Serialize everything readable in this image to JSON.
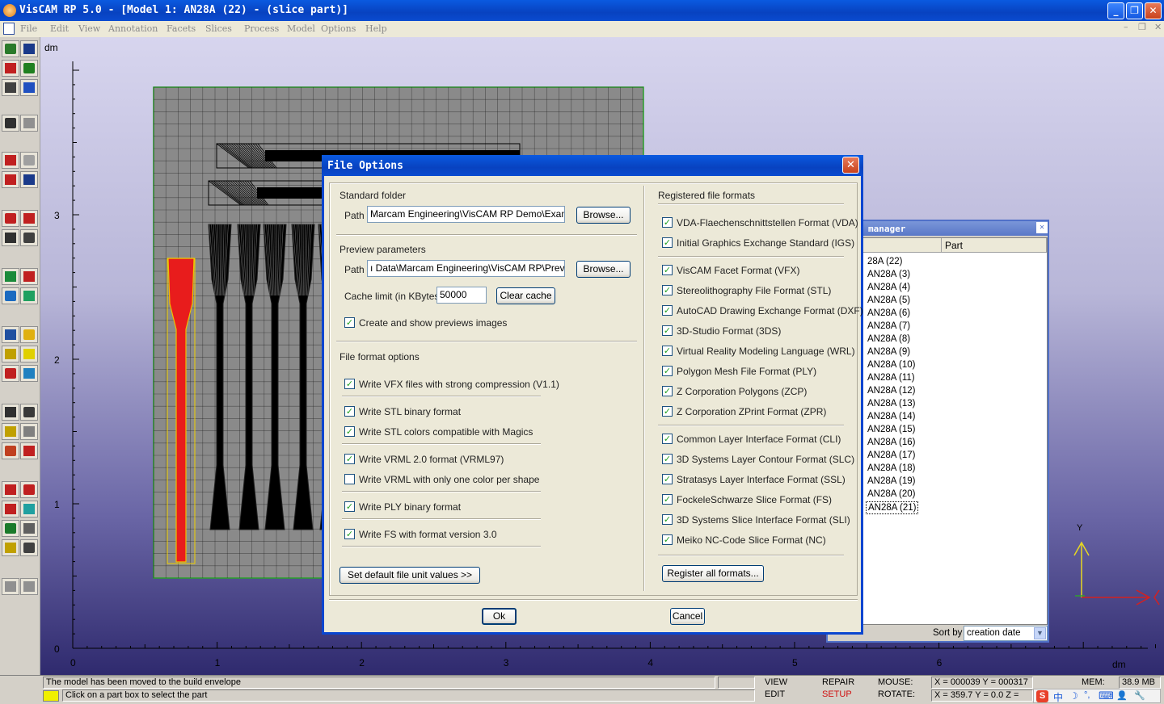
{
  "window": {
    "title": "VisCAM RP 5.0 - [Model 1: AN28A (22) - (slice part)]",
    "minimize": "_",
    "restore": "❐",
    "close": "✕"
  },
  "menu": {
    "items": [
      "File",
      "Edit",
      "View",
      "Annotation",
      "Facets",
      "Slices",
      "Process",
      "Model",
      "Options",
      "Help"
    ],
    "mdi_controls": [
      "–",
      "❐",
      "✕"
    ]
  },
  "toolbar": {
    "buttons": [
      "open",
      "save",
      "cut",
      "copy",
      "print",
      "paint",
      "undo",
      "redo",
      "rp-slice",
      "layers",
      "sort-down",
      "toggle",
      "layer-down",
      "layer-up",
      "stack",
      "stack2",
      "cube",
      "no-select",
      "move",
      "rotate-face",
      "part-dim",
      "settings",
      "grid",
      "grid-fill",
      "transform",
      "rotate",
      "ruler",
      "dollar",
      "hatch",
      "hatch-x",
      "layer-fill",
      "cross",
      "cube-red",
      "cube-box",
      "flip",
      "globe",
      "move-arrows",
      "rotate-arc",
      "lasso",
      "zoom",
      "back",
      "forward"
    ],
    "accent": "#c02020"
  },
  "viewport": {
    "y_unit": "dm",
    "x_unit": "dm",
    "y_ticks": [
      {
        "v": 0,
        "label": "0"
      },
      {
        "v": 1,
        "label": "1"
      },
      {
        "v": 2,
        "label": "2"
      },
      {
        "v": 3,
        "label": "3"
      }
    ],
    "x_ticks": [
      {
        "v": 0,
        "label": "0"
      },
      {
        "v": 1,
        "label": "1"
      },
      {
        "v": 2,
        "label": "2"
      },
      {
        "v": 3,
        "label": "3"
      },
      {
        "v": 4,
        "label": "4"
      },
      {
        "v": 5,
        "label": "5"
      },
      {
        "v": 6,
        "label": "6"
      }
    ],
    "axis_y_label": "Y",
    "colors": {
      "plate": "#8a8a8a",
      "grid": "#1a1a1a",
      "border": "#2aa02a",
      "selected": "#e81c1c",
      "axis": "#e8d820",
      "axis_x": "#d42020"
    }
  },
  "parts_manager": {
    "title": "manager",
    "columns": [
      "",
      "Part"
    ],
    "rows": [
      "28A (22)",
      "AN28A (3)",
      "AN28A (4)",
      "AN28A (5)",
      "AN28A (6)",
      "AN28A (7)",
      "AN28A (8)",
      "AN28A (9)",
      "AN28A (10)",
      "AN28A (11)",
      "AN28A (12)",
      "AN28A (13)",
      "AN28A (14)",
      "AN28A (15)",
      "AN28A (16)",
      "AN28A (17)",
      "AN28A (18)",
      "AN28A (19)",
      "AN28A (20)",
      "AN28A (21)"
    ],
    "sort_label": "Sort by",
    "sort_value": "creation date",
    "close": "✕"
  },
  "dialog": {
    "title": "File Options",
    "close": "✕",
    "standard_folder": {
      "heading": "Standard folder",
      "path_label": "Path",
      "path_value": "Marcam Engineering\\VisCAM RP Demo\\Examples\\",
      "browse": "Browse..."
    },
    "preview": {
      "heading": "Preview parameters",
      "path_label": "Path",
      "path_value": "ı Data\\Marcam Engineering\\VisCAM RP\\Previews",
      "browse": "Browse...",
      "cache_label": "Cache limit (in KBytes)",
      "cache_value": "50000",
      "clear_cache": "Clear cache",
      "create_previews": {
        "label": "Create and show previews images",
        "checked": true
      }
    },
    "file_format_options": {
      "heading": "File format options",
      "options": [
        {
          "label": "Write VFX files with strong compression (V1.1)",
          "checked": true
        },
        {
          "label": "Write STL binary format",
          "checked": true
        },
        {
          "label": "Write STL colors compatible with Magics",
          "checked": true
        },
        {
          "label": "Write VRML 2.0 format (VRML97)",
          "checked": true
        },
        {
          "label": "Write VRML with only one color per shape",
          "checked": false
        },
        {
          "label": "Write PLY binary format",
          "checked": true
        },
        {
          "label": "Write FS with format version 3.0",
          "checked": true
        }
      ]
    },
    "set_default": "Set default file unit values  >>",
    "registered": {
      "heading": "Registered file formats",
      "formats": [
        {
          "label": "VDA-Flaechenschnittstellen Format (VDA)",
          "checked": true
        },
        {
          "label": "Initial Graphics Exchange Standard (IGS)",
          "checked": true
        },
        {
          "label": "VisCAM Facet Format (VFX)",
          "checked": true
        },
        {
          "label": "Stereolithography File Format (STL)",
          "checked": true
        },
        {
          "label": "AutoCAD Drawing Exchange Format (DXF)",
          "checked": true
        },
        {
          "label": "3D-Studio Format (3DS)",
          "checked": true
        },
        {
          "label": "Virtual Reality Modeling Language (WRL)",
          "checked": true
        },
        {
          "label": "Polygon Mesh File Format (PLY)",
          "checked": true
        },
        {
          "label": "Z Corporation Polygons (ZCP)",
          "checked": true
        },
        {
          "label": "Z Corporation ZPrint Format (ZPR)",
          "checked": true
        },
        {
          "label": "Common Layer Interface Format (CLI)",
          "checked": true
        },
        {
          "label": "3D Systems Layer Contour Format (SLC)",
          "checked": true
        },
        {
          "label": "Stratasys Layer Interface Format (SSL)",
          "checked": true
        },
        {
          "label": "FockeleSchwarze Slice Format (FS)",
          "checked": true
        },
        {
          "label": "3D Systems Slice Interface Format (SLI)",
          "checked": true
        },
        {
          "label": "Meiko NC-Code Slice Format (NC)",
          "checked": true
        }
      ],
      "register_all": "Register all formats..."
    },
    "ok": "Ok",
    "cancel": "Cancel",
    "check_mark": "✓"
  },
  "status": {
    "message1": "The model has been moved to the build envelope",
    "message2": "Click on a part box to select the part",
    "view": "VIEW",
    "edit": "EDIT",
    "repair": "REPAIR",
    "setup": "SETUP",
    "mouse_label": "MOUSE:",
    "mouse_value": "X = 000039   Y = 000317",
    "rotate_label": "ROTATE:",
    "rotate_value": "X = 359.7    Y = 0.0    Z =",
    "mem_label": "MEM:",
    "mem_value": "38.9 MB",
    "ime_items": [
      "S",
      "中",
      "☽",
      "°,",
      "⌨",
      "👤",
      "🔧"
    ]
  }
}
